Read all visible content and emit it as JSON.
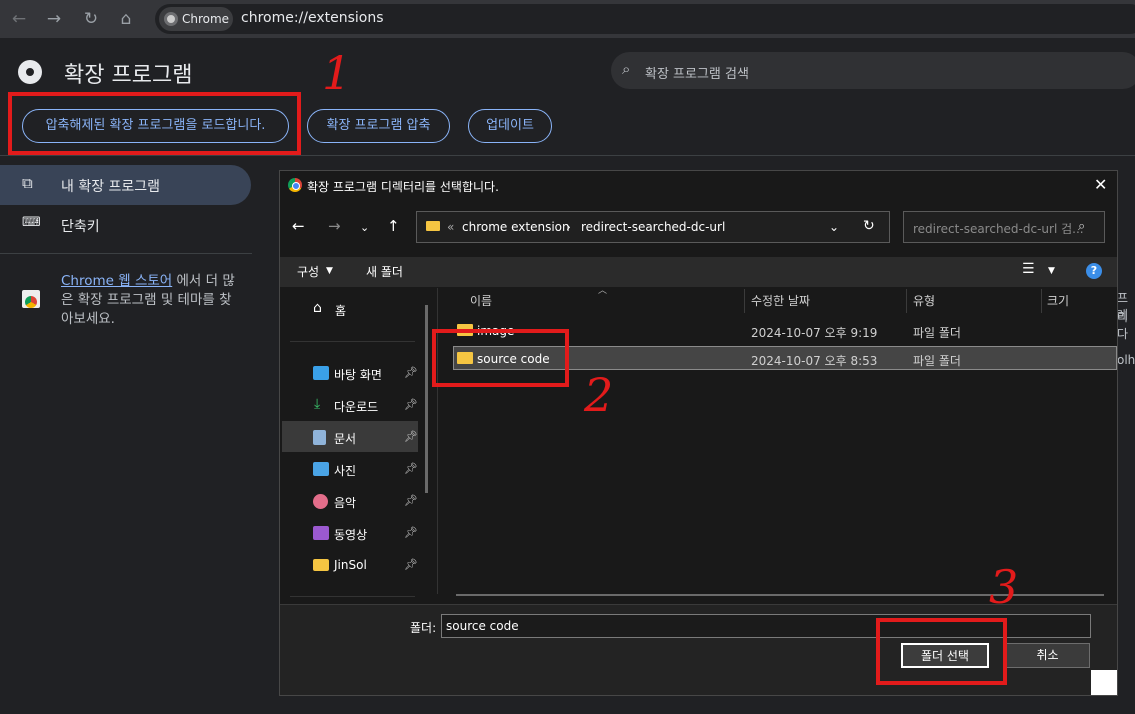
{
  "browser": {
    "chip_label": "Chrome",
    "url": "chrome://extensions"
  },
  "extensions": {
    "title": "확장 프로그램",
    "search_placeholder": "확장 프로그램 검색",
    "buttons": {
      "load_unpacked": "압축해제된 확장 프로그램을 로드합니다.",
      "pack": "확장 프로그램 압축",
      "update": "업데이트"
    },
    "sidebar": {
      "my_extensions": "내 확장 프로그램",
      "shortcuts": "단축키",
      "store_link": "Chrome 웹 스토어",
      "store_text": "에서 더 많은 확장 프로그램 및 테마를 찾아보세요."
    },
    "behind_fragments": [
      "프레",
      "리다",
      "olhk"
    ]
  },
  "dialog": {
    "title": "확장 프로그램 디렉터리를 선택합니다.",
    "breadcrumb": {
      "prefix": "«",
      "parent": "chrome extension",
      "current": "redirect-searched-dc-url"
    },
    "search_placeholder": "redirect-searched-dc-url 검...",
    "toolbar": {
      "organize": "구성",
      "new_folder": "새 폴더"
    },
    "nav": {
      "home": "홈",
      "items": [
        {
          "label": "바탕 화면",
          "icon": "desktop-icon",
          "color": "#3aa0e8"
        },
        {
          "label": "다운로드",
          "icon": "download-icon",
          "color": "#3ac16a"
        },
        {
          "label": "문서",
          "icon": "document-icon",
          "color": "#8fb3d9"
        },
        {
          "label": "사진",
          "icon": "pictures-icon",
          "color": "#4aa4e6"
        },
        {
          "label": "음악",
          "icon": "music-icon",
          "color": "#e36d8a"
        },
        {
          "label": "동영상",
          "icon": "videos-icon",
          "color": "#9b59d0"
        },
        {
          "label": "JinSol",
          "icon": "folder-icon",
          "color": "#f5c542"
        }
      ]
    },
    "columns": {
      "name": "이름",
      "modified": "수정한 날짜",
      "type": "유형",
      "size": "크기"
    },
    "files": [
      {
        "name": "image",
        "modified": "2024-10-07 오후 9:19",
        "type": "파일 폴더"
      },
      {
        "name": "source code",
        "modified": "2024-10-07 오후 8:53",
        "type": "파일 폴더"
      }
    ],
    "folder_label": "폴더:",
    "folder_value": "source code",
    "select_button": "폴더 선택",
    "cancel_button": "취소"
  },
  "annotations": {
    "step1": "1",
    "step2": "2",
    "step3": "3",
    "color": "#e21b1b"
  }
}
